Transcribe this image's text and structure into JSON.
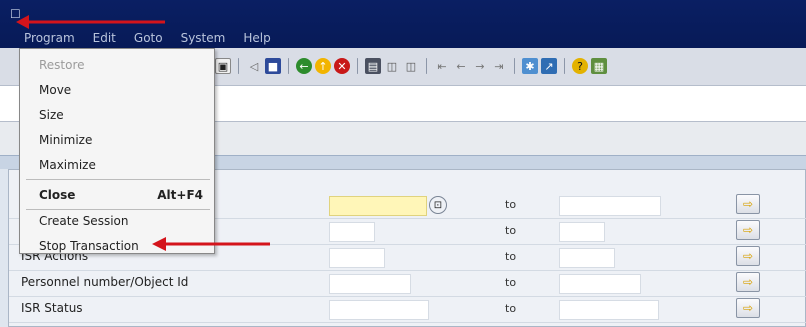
{
  "window": {
    "system_icon": "window-system-icon",
    "menu": [
      "Program",
      "Edit",
      "Goto",
      "System",
      "Help"
    ]
  },
  "toolbar": {
    "icons": [
      "enter-icon",
      "back-icon",
      "save-icon",
      "green-back-icon",
      "exit-icon",
      "cancel-icon",
      "print-icon",
      "find-icon",
      "find-next-icon",
      "first-page-icon",
      "previous-page-icon",
      "next-page-icon",
      "last-page-icon",
      "create-session-icon",
      "shortcut-icon",
      "help-icon",
      "layout-icon"
    ]
  },
  "system_menu": {
    "items": [
      {
        "label": "Restore",
        "disabled": true
      },
      {
        "label": "Move"
      },
      {
        "label": "Size"
      },
      {
        "label": "Minimize"
      },
      {
        "label": "Maximize"
      },
      {
        "label": "Close",
        "shortcut": "Alt+F4",
        "bold": true
      },
      {
        "label": "Create Session"
      },
      {
        "label": "Stop Transaction"
      }
    ]
  },
  "form": {
    "to_label": "to",
    "rows": [
      {
        "label": ""
      },
      {
        "label": ""
      },
      {
        "label": "ISR Actions"
      },
      {
        "label": "Personnel number/Object Id"
      },
      {
        "label": "ISR Status"
      }
    ]
  },
  "colors": {
    "title_bar": "#0a1f63",
    "annotation_arrow": "#d4141b"
  }
}
